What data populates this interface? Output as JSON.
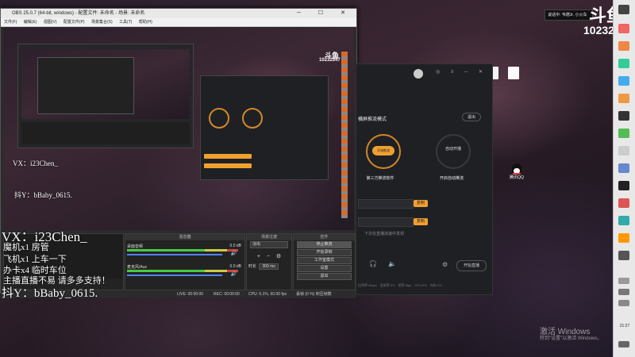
{
  "obs": {
    "title": "OBS 25.0.7 (64-bit, windows) - 配置文件: 未命名 - 场景: 未命名",
    "menu": [
      "文件(F)",
      "编辑(E)",
      "视图(V)",
      "配置文件(P)",
      "场景集合(S)",
      "工具(T)",
      "帮助(H)"
    ],
    "panels": {
      "audio_mixer": "混音器",
      "transitions": "场景过渡",
      "controls": "控件"
    },
    "mixer_tracks": [
      {
        "name": "桌面音频",
        "level": "0.0 dB"
      },
      {
        "name": "麦克风/Aux",
        "level": "0.0 dB"
      }
    ],
    "transition": {
      "type": "淡出",
      "duration_label": "时长",
      "duration": "300 ms"
    },
    "controls": [
      "停止推流",
      "开始录制",
      "工作室模式",
      "设置",
      "退出"
    ],
    "status": {
      "live": "LIVE: 00:00:00",
      "rec": "REC: 00:00:00",
      "cpu": "CPU: 5.1%, 60.00 fps",
      "dropped": "丢帧 (0 %)  积压帧数"
    }
  },
  "overlay": {
    "douyu_logo": "斗鱼",
    "room_id": "10232547",
    "lines": [
      "VX：i23Chen_",
      "魔机x1 房管",
      "飞机x1 上车一下",
      "办卡x4 临时车位",
      "主播直播不易 请多多支持！",
      "抖Y：bBaby_0615."
    ]
  },
  "notification": "谈话中: 韦德Jr.  小火车",
  "douyu": {
    "mode": "横屏推流模式",
    "exit": "退出",
    "tool_start": "开始推流",
    "tool_start_desc": "第三方推流软件",
    "tool_auto": "自动开播",
    "tool_auto_desc": "开启自动推流",
    "copy": "复制",
    "copy2": "复制",
    "hint": "下次在直播加速中发现",
    "start_live": "开始直播",
    "stats": [
      "比特率:0kbps",
      "丢帧率:0%",
      "帧率:0fps",
      "CPU:0%",
      "内存:0%"
    ]
  },
  "desktop_icons": [
    "QQ",
    "腾讯QQ"
  ],
  "activation": {
    "title": "激活 Windows",
    "desc": "转到\"设置\"以激活 Windows。"
  },
  "clock": "21:27"
}
